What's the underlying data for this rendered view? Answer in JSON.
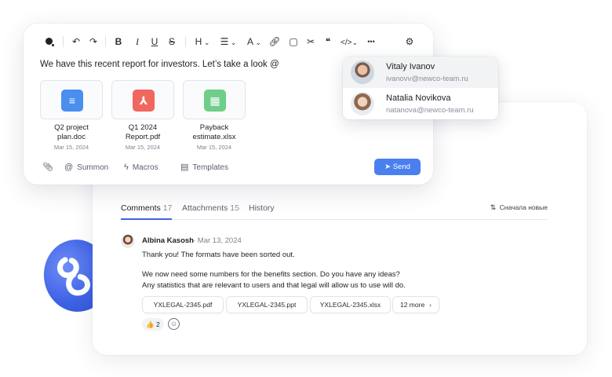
{
  "editor": {
    "toolbar": {
      "undo_icon": "undo-icon",
      "redo_icon": "redo-icon",
      "bold": "B",
      "italic": "I",
      "underline": "U",
      "strike": "S",
      "heading": "H",
      "list_icon": "list-icon",
      "text_color": "A",
      "more": "•••"
    },
    "text": "We have this recent report for investors. Let’s take a look @",
    "files": [
      {
        "name_line1": "Q2 project",
        "name_line2": "plan.doc",
        "date": "Mar 15, 2024",
        "icon": "document-icon",
        "color": "#4a8ef0"
      },
      {
        "name_line1": "Q1 2024",
        "name_line2": "Report.pdf",
        "date": "Mar 15, 2024",
        "icon": "pdf-icon",
        "color": "#f0675f"
      },
      {
        "name_line1": "Payback",
        "name_line2": "estimate.xlsx",
        "date": "Mar 15, 2024",
        "icon": "spreadsheet-icon",
        "color": "#6fce8a"
      }
    ],
    "bottom": {
      "summon": "Summon",
      "macros": "Macros",
      "templates": "Templates",
      "send": "Send"
    }
  },
  "mentions": [
    {
      "name": "Vitaly Ivanov",
      "email": "ivanovv@newco-team.ru",
      "selected": true
    },
    {
      "name": "Natalia Novikova",
      "email": "natanova@newco-team.ru",
      "selected": false
    }
  ],
  "panel": {
    "tabs": [
      {
        "label": "Comments",
        "count": "17",
        "active": true
      },
      {
        "label": "Attachments",
        "count": "15",
        "active": false
      },
      {
        "label": "History",
        "count": "",
        "active": false
      }
    ],
    "sort_label": "Сначала новые",
    "comment": {
      "author": "Albina Kasosh",
      "date": "· Mar 13, 2024",
      "line1": "Thank you! The formats have been sorted out.",
      "line2": "We now need some numbers for the benefits section. Do you have any ideas?",
      "line3": "Any statistics that are relevant to users and that legal will allow us to use will do.",
      "attachments": [
        "YXLEGAL-2345.pdf",
        "YXLEGAL-2345.ppt",
        "YXLEGAL-2345.xlsx"
      ],
      "more_label": "12 more",
      "reaction_emoji": "👍",
      "reaction_count": "2"
    }
  },
  "colors": {
    "accent": "#4a7ff0",
    "tab_underline": "#3f63e6"
  }
}
